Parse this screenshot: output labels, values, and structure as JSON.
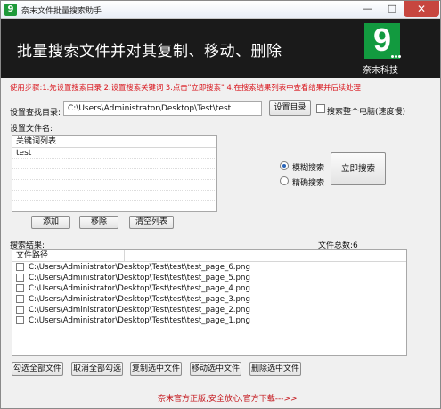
{
  "window": {
    "title": "奈末文件批量搜索助手",
    "app_icon_glyph": "9",
    "controls": {
      "minimize": "—",
      "maximize": "□",
      "close": "✕"
    }
  },
  "banner": {
    "title": "批量搜索文件并对其复制、移动、删除",
    "logo_text": "9",
    "brand": "奈末科技"
  },
  "steps_text": "使用步骤:1.先设置搜索目录 2.设置搜索关键词 3.点击\"立即搜索\" 4.在搜索结果列表中查看结果并后续处理",
  "directory": {
    "label": "设置查找目录:",
    "value": "C:\\Users\\Administrator\\Desktop\\Test\\test",
    "set_button": "设置目录",
    "search_whole_pc_label": "搜索整个电脑(速度慢)",
    "search_whole_pc_checked": false
  },
  "filename": {
    "label": "设置文件名:",
    "list_header": "关键词列表",
    "keywords": [
      "test"
    ],
    "buttons": {
      "add": "添加",
      "remove": "移除",
      "clear": "清空列表"
    }
  },
  "search_mode": {
    "fuzzy_label": "模糊搜索",
    "exact_label": "精确搜索",
    "selected": "fuzzy",
    "search_button": "立即搜索"
  },
  "results": {
    "label": "搜索结果:",
    "total_label": "文件总数:",
    "total": "6",
    "column_header": "文件路径",
    "rows": [
      "C:\\Users\\Administrator\\Desktop\\Test\\test\\test_page_6.png",
      "C:\\Users\\Administrator\\Desktop\\Test\\test\\test_page_5.png",
      "C:\\Users\\Administrator\\Desktop\\Test\\test\\test_page_4.png",
      "C:\\Users\\Administrator\\Desktop\\Test\\test\\test_page_3.png",
      "C:\\Users\\Administrator\\Desktop\\Test\\test\\test_page_2.png",
      "C:\\Users\\Administrator\\Desktop\\Test\\test\\test_page_1.png"
    ]
  },
  "actions": {
    "check_all": "勾选全部文件",
    "uncheck_all": "取消全部勾选",
    "copy_selected": "复制选中文件",
    "move_selected": "移动选中文件",
    "delete_selected": "删除选中文件"
  },
  "footer_text": "奈末官方正版,安全放心,官方下载--->>",
  "colors": {
    "banner_bg": "#1a1a1a",
    "logo_green": "#129a3f",
    "steps_red": "#d9141b",
    "close_red": "#c7463f"
  }
}
